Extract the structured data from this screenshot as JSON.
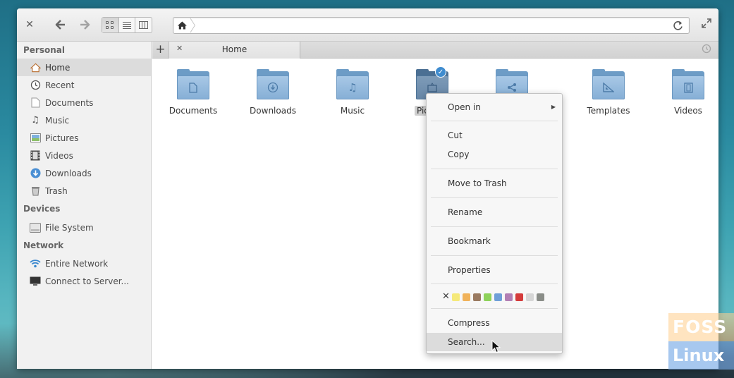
{
  "window": {
    "tab_label": "Home",
    "path_home_icon": "home-icon"
  },
  "sidebar": {
    "sections": [
      {
        "heading": "Personal",
        "items": [
          {
            "label": "Home",
            "icon": "home-icon",
            "selected": true
          },
          {
            "label": "Recent",
            "icon": "clock-icon"
          },
          {
            "label": "Documents",
            "icon": "document-icon"
          },
          {
            "label": "Music",
            "icon": "music-icon"
          },
          {
            "label": "Pictures",
            "icon": "picture-icon"
          },
          {
            "label": "Videos",
            "icon": "film-icon"
          },
          {
            "label": "Downloads",
            "icon": "download-icon"
          },
          {
            "label": "Trash",
            "icon": "trash-icon"
          }
        ]
      },
      {
        "heading": "Devices",
        "items": [
          {
            "label": "File System",
            "icon": "drive-icon"
          }
        ]
      },
      {
        "heading": "Network",
        "items": [
          {
            "label": "Entire Network",
            "icon": "wifi-icon"
          },
          {
            "label": "Connect to Server...",
            "icon": "monitor-icon"
          }
        ]
      }
    ]
  },
  "folders": [
    {
      "label": "Documents",
      "glyph": "document-icon"
    },
    {
      "label": "Downloads",
      "glyph": "download-icon"
    },
    {
      "label": "Music",
      "glyph": "music-icon"
    },
    {
      "label": "Pic",
      "glyph": "picture-icon",
      "selected": true
    },
    {
      "label": "",
      "glyph": "share-icon"
    },
    {
      "label": "Templates",
      "glyph": "template-icon"
    },
    {
      "label": "Videos",
      "glyph": "film-icon"
    }
  ],
  "context_menu": {
    "open_in": "Open in",
    "cut": "Cut",
    "copy": "Copy",
    "move_to_trash": "Move to Trash",
    "rename": "Rename",
    "bookmark": "Bookmark",
    "properties": "Properties",
    "compress": "Compress",
    "search": "Search...",
    "color_tags": [
      "#f5e97a",
      "#f0b25a",
      "#9a7a60",
      "#8ed25a",
      "#6f9fd8",
      "#b27fb4",
      "#d43b3b",
      "#d6d6d6",
      "#8a8d88"
    ]
  },
  "watermark": {
    "line1": "FOSS",
    "line2": "Linux"
  }
}
